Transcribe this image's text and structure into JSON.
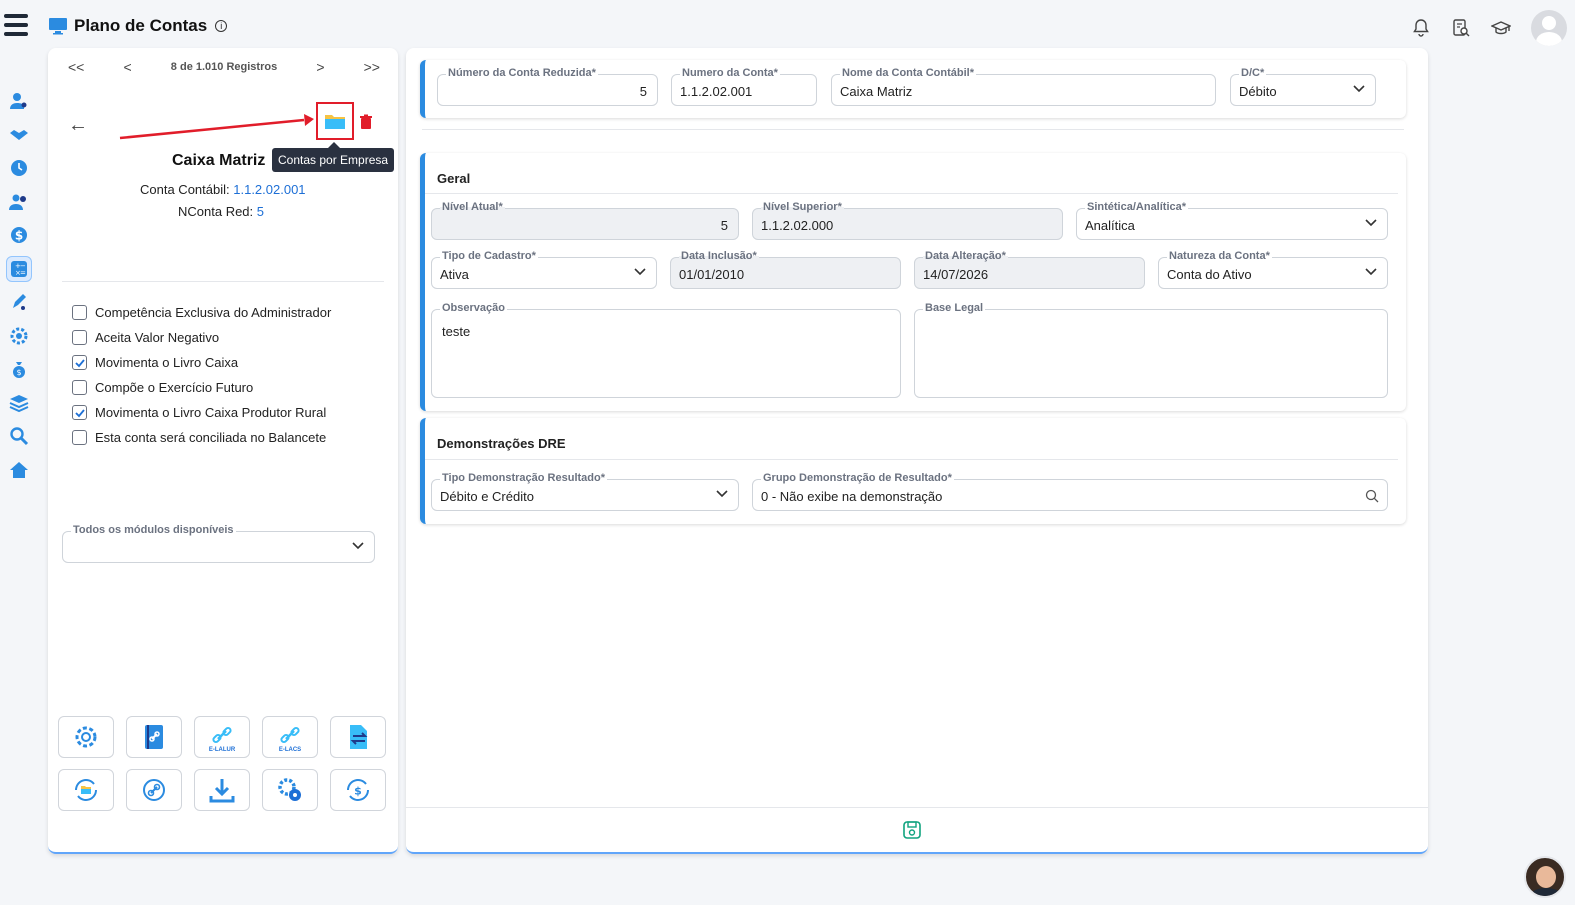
{
  "header": {
    "title": "Plano de Contas",
    "icons": [
      "menu-icon",
      "monitor-icon",
      "info-icon",
      "bell-icon",
      "document-search-icon",
      "graduation-cap-icon",
      "user-avatar"
    ]
  },
  "rail": {
    "items": [
      "user-settings-icon",
      "handshake-icon",
      "clock-icon",
      "users-icon",
      "dollar-icon",
      "calculator-icon",
      "pen-icon",
      "gears-icon",
      "money-bag-icon",
      "layers-icon",
      "search-icon",
      "home-icon"
    ],
    "active_index": 5
  },
  "left": {
    "pager": {
      "first": "<<",
      "prev": "<",
      "info": "8 de 1.010 Registros",
      "next": ">",
      "last": ">>"
    },
    "tooltip": "Contas por Empresa",
    "account_name": "Caixa Matriz",
    "conta_contabil_label": "Conta Contábil:",
    "conta_contabil_value": "1.1.2.02.001",
    "nconta_label": "NConta Red:",
    "nconta_value": "5",
    "checkboxes": [
      {
        "label": "Competência Exclusiva do Administrador",
        "checked": false
      },
      {
        "label": "Aceita Valor Negativo",
        "checked": false
      },
      {
        "label": "Movimenta o Livro Caixa",
        "checked": true
      },
      {
        "label": "Compõe o Exercício Futuro",
        "checked": false
      },
      {
        "label": "Movimenta o Livro Caixa Produtor Rural",
        "checked": true
      },
      {
        "label": "Esta conta será conciliada no Balancete",
        "checked": false
      }
    ],
    "modules_label": "Todos os módulos disponíveis",
    "modules_value": "",
    "tools": [
      {
        "icon": "gear-icon",
        "label": ""
      },
      {
        "icon": "book-link-icon",
        "label": ""
      },
      {
        "icon": "link-icon",
        "label": "E-LALUR"
      },
      {
        "icon": "link-icon",
        "label": "E-LACS"
      },
      {
        "icon": "file-transfer-icon",
        "label": ""
      },
      {
        "icon": "folder-sync-icon",
        "label": ""
      },
      {
        "icon": "link-sync-icon",
        "label": ""
      },
      {
        "icon": "download-icon",
        "label": ""
      },
      {
        "icon": "gears-icon",
        "label": ""
      },
      {
        "icon": "dollar-sync-icon",
        "label": ""
      }
    ]
  },
  "top_fields": {
    "reduzida": {
      "label": "Número da Conta Reduzida*",
      "value": "5"
    },
    "numero": {
      "label": "Numero da Conta*",
      "value": "1.1.2.02.001"
    },
    "nome": {
      "label": "Nome da Conta Contábil*",
      "value": "Caixa Matriz"
    },
    "dc": {
      "label": "D/C*",
      "value": "Débito"
    }
  },
  "geral": {
    "title": "Geral",
    "nivel_atual": {
      "label": "Nível Atual*",
      "value": "5"
    },
    "nivel_superior": {
      "label": "Nível Superior*",
      "value": "1.1.2.02.000"
    },
    "sintetica": {
      "label": "Sintética/Analítica*",
      "value": "Analítica"
    },
    "tipo_cadastro": {
      "label": "Tipo de Cadastro*",
      "value": "Ativa"
    },
    "data_inclusao": {
      "label": "Data Inclusão*",
      "value": "01/01/2010"
    },
    "data_alteracao": {
      "label": "Data Alteração*",
      "value": "14/07/2026"
    },
    "natureza": {
      "label": "Natureza da Conta*",
      "value": "Conta do Ativo"
    },
    "observacao": {
      "label": "Observação",
      "value": "teste"
    },
    "base_legal": {
      "label": "Base Legal",
      "value": ""
    }
  },
  "dre": {
    "title": "Demonstrações DRE",
    "tipo": {
      "label": "Tipo Demonstração Resultado*",
      "value": "Débito e Crédito"
    },
    "grupo": {
      "label": "Grupo Demonstração de Resultado*",
      "value": "0 - Não exibe na demonstração"
    }
  },
  "colors": {
    "accent": "#2b8be0",
    "link": "#1d6fd6",
    "danger": "#e11d2a",
    "save": "#10a37f"
  }
}
